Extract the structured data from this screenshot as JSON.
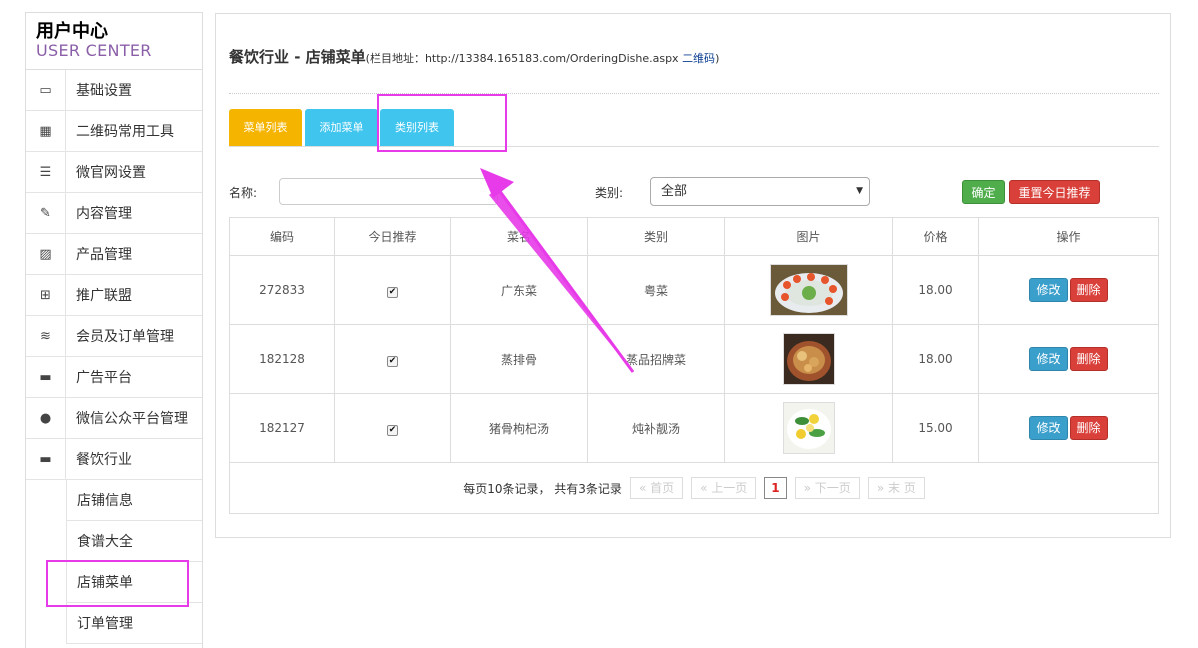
{
  "sidebar": {
    "brand_cn": "用户中心",
    "brand_en": "USER CENTER",
    "items": [
      {
        "label": "基础设置",
        "icon": "monitor-icon",
        "glyph": "▭"
      },
      {
        "label": "二维码常用工具",
        "icon": "qrcode-icon",
        "glyph": "▦"
      },
      {
        "label": "微官网设置",
        "icon": "list-icon",
        "glyph": "☰"
      },
      {
        "label": "内容管理",
        "icon": "edit-icon",
        "glyph": "✎"
      },
      {
        "label": "产品管理",
        "icon": "image-icon",
        "glyph": "▨"
      },
      {
        "label": "推广联盟",
        "icon": "gift-icon",
        "glyph": "⊞"
      },
      {
        "label": "会员及订单管理",
        "icon": "database-icon",
        "glyph": "≋"
      },
      {
        "label": "广告平台",
        "icon": "cup-icon",
        "glyph": "▬"
      },
      {
        "label": "微信公众平台管理",
        "icon": "chat-icon",
        "glyph": "●"
      },
      {
        "label": "餐饮行业",
        "icon": "coffee-icon",
        "glyph": "▬"
      }
    ],
    "sub_items": [
      "店铺信息",
      "食谱大全",
      "店铺菜单",
      "订单管理"
    ]
  },
  "header": {
    "title": "餐饮行业 - 店铺菜单",
    "addr_prefix": "(栏目地址：http://13384.165183.com/OrderingDishe.aspx ",
    "qr_link": "二维码",
    "addr_suffix": ")"
  },
  "tabs": [
    "菜单列表",
    "添加菜单",
    "类别列表"
  ],
  "filter": {
    "name_label": "名称:",
    "name_value": "",
    "category_label": "类别:",
    "category_value": "全部",
    "ok_button": "确定",
    "reset_button": "重置今日推荐"
  },
  "table": {
    "headers": [
      "编码",
      "今日推荐",
      "菜名",
      "类别",
      "图片",
      "价格",
      "操作"
    ],
    "rows": [
      {
        "code": "272833",
        "recommended": true,
        "name": "广东菜",
        "category": "粤菜",
        "price": "18.00"
      },
      {
        "code": "182128",
        "recommended": true,
        "name": "蒸排骨",
        "category": "蒸品招牌菜",
        "price": "18.00"
      },
      {
        "code": "182127",
        "recommended": true,
        "name": "猪骨枸杞汤",
        "category": "炖补靓汤",
        "price": "15.00"
      }
    ],
    "edit_label": "修改",
    "delete_label": "删除"
  },
  "pager": {
    "summary": "每页10条记录， 共有3条记录",
    "first": "« 首页",
    "prev": "« 上一页",
    "current": "1",
    "next": "» 下一页",
    "last": "» 末 页"
  },
  "colors": {
    "tab_active": "#f4b400",
    "tab": "#3fc5ee",
    "annotation": "#e73ae8"
  }
}
